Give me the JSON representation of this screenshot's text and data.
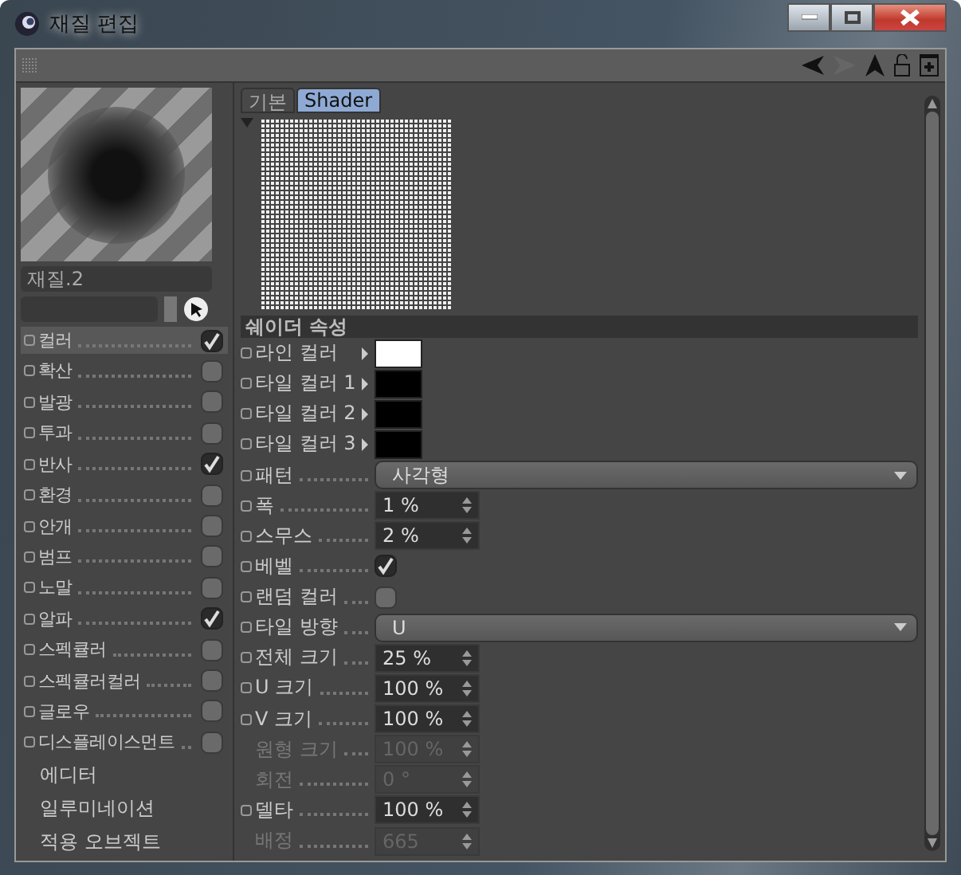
{
  "window": {
    "title": "재질 편집"
  },
  "material": {
    "name": "재질.2"
  },
  "channels": [
    {
      "kind": "channel",
      "label": "컬러",
      "checked": true,
      "selected": true
    },
    {
      "kind": "channel",
      "label": "확산",
      "checked": false,
      "selected": false
    },
    {
      "kind": "channel",
      "label": "발광",
      "checked": false,
      "selected": false
    },
    {
      "kind": "channel",
      "label": "투과",
      "checked": false,
      "selected": false
    },
    {
      "kind": "channel",
      "label": "반사",
      "checked": true,
      "selected": false
    },
    {
      "kind": "channel",
      "label": "환경",
      "checked": false,
      "selected": false
    },
    {
      "kind": "channel",
      "label": "안개",
      "checked": false,
      "selected": false
    },
    {
      "kind": "channel",
      "label": "범프",
      "checked": false,
      "selected": false
    },
    {
      "kind": "channel",
      "label": "노말",
      "checked": false,
      "selected": false
    },
    {
      "kind": "channel",
      "label": "알파",
      "checked": true,
      "selected": false
    },
    {
      "kind": "channel",
      "label": "스펙큘러",
      "checked": false,
      "selected": false
    },
    {
      "kind": "channel",
      "label": "스펙큘러컬러",
      "checked": false,
      "selected": false
    },
    {
      "kind": "channel",
      "label": "글로우",
      "checked": false,
      "selected": false
    },
    {
      "kind": "channel",
      "label": "디스플레이스먼트",
      "checked": false,
      "selected": false
    },
    {
      "kind": "link",
      "label": "에디터",
      "selected": false
    },
    {
      "kind": "link",
      "label": "일루미네이션",
      "selected": false
    },
    {
      "kind": "link",
      "label": "적용 오브젝트",
      "selected": false
    }
  ],
  "tabs": [
    {
      "label": "기본",
      "selected": false
    },
    {
      "label": "Shader",
      "selected": true
    }
  ],
  "section": {
    "title": "쉐이더 속성"
  },
  "params": [
    {
      "kind": "color",
      "label": "라인 컬러",
      "color": "#ffffff",
      "disabled": false
    },
    {
      "kind": "color",
      "label": "타일 컬러 1",
      "color": "#000000",
      "disabled": false
    },
    {
      "kind": "color",
      "label": "타일 컬러 2",
      "color": "#000000",
      "disabled": false
    },
    {
      "kind": "color",
      "label": "타일 컬러 3",
      "color": "#000000",
      "disabled": false
    },
    {
      "kind": "dropdown",
      "label": "패턴",
      "value": "사각형",
      "disabled": false
    },
    {
      "kind": "number",
      "label": "폭",
      "value": "1 %",
      "disabled": false
    },
    {
      "kind": "number",
      "label": "스무스",
      "value": "2 %",
      "disabled": false
    },
    {
      "kind": "checkbox",
      "label": "베벨",
      "checked": true,
      "disabled": false
    },
    {
      "kind": "checkbox",
      "label": "랜덤 컬러",
      "checked": false,
      "disabled": false
    },
    {
      "kind": "dropdown",
      "label": "타일 방향",
      "value": "U",
      "disabled": false
    },
    {
      "kind": "number",
      "label": "전체 크기",
      "value": "25 %",
      "disabled": false
    },
    {
      "kind": "number",
      "label": "U 크기",
      "value": "100 %",
      "disabled": false
    },
    {
      "kind": "number",
      "label": "V 크기",
      "value": "100 %",
      "disabled": false
    },
    {
      "kind": "number",
      "label": "원형 크기",
      "value": "100 %",
      "disabled": true
    },
    {
      "kind": "number",
      "label": "회전",
      "value": "0 °",
      "disabled": true
    },
    {
      "kind": "number",
      "label": "델타",
      "value": "100 %",
      "disabled": false
    },
    {
      "kind": "number",
      "label": "배정",
      "value": "665",
      "disabled": true
    }
  ]
}
